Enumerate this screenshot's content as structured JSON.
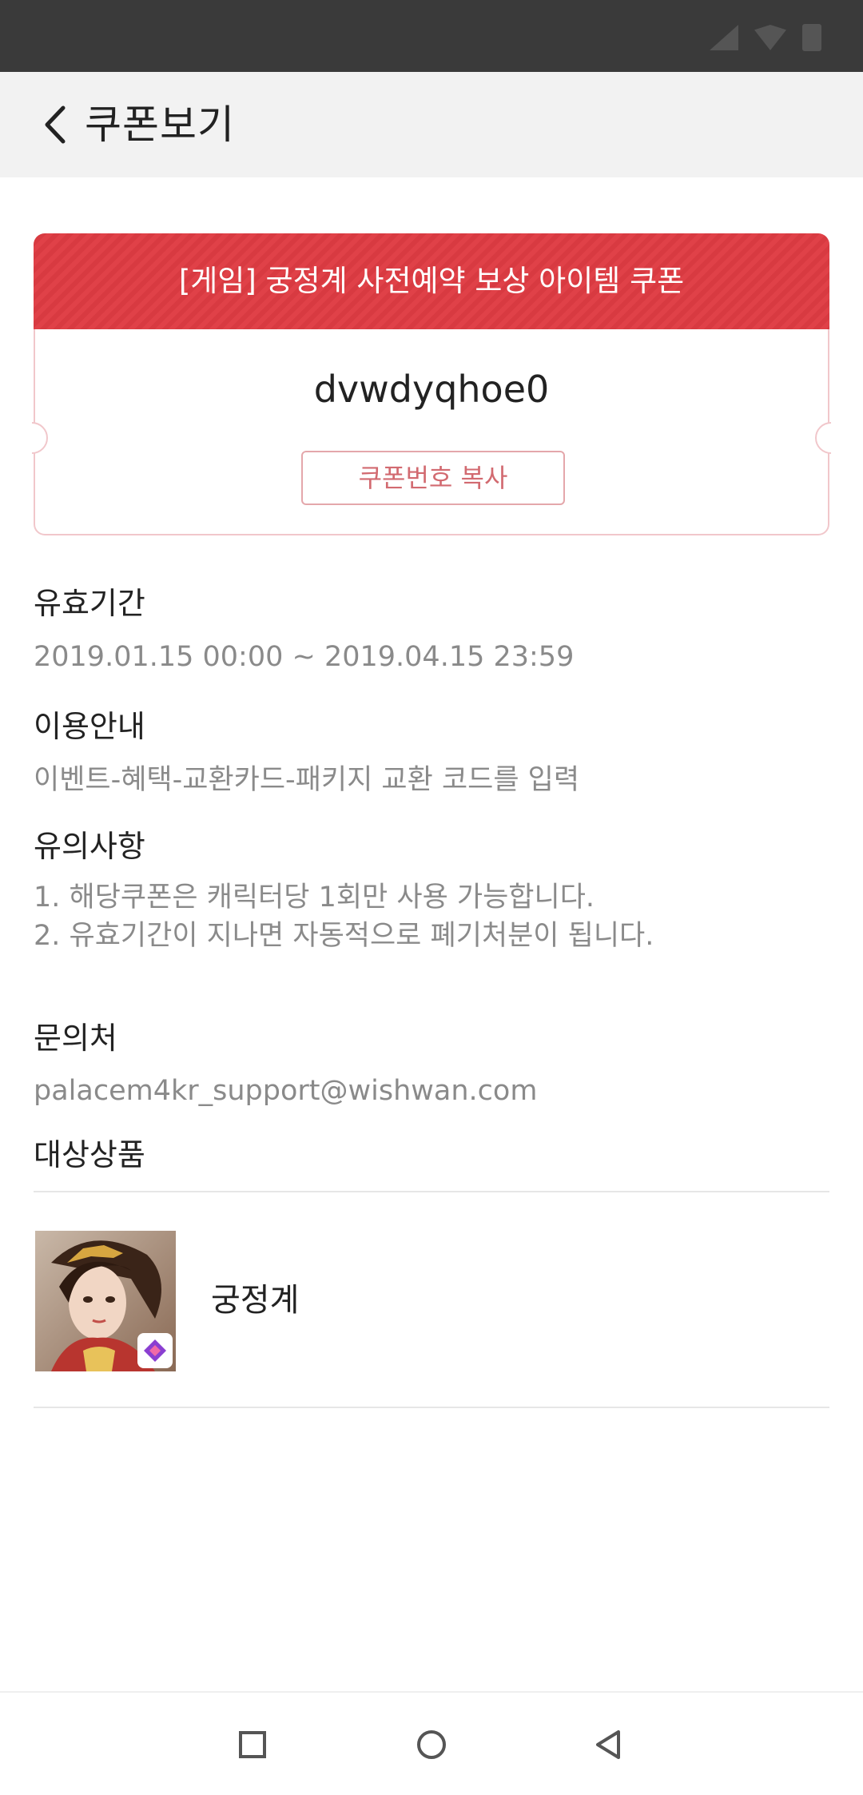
{
  "status_bar": {
    "icons": [
      "signal-icon",
      "wifi-icon",
      "battery-icon"
    ]
  },
  "app_bar": {
    "back_icon": "chevron-left-icon",
    "title": "쿠폰보기"
  },
  "coupon": {
    "title": "[게임] 궁정계 사전예약 보상 아이템 쿠폰",
    "code": "dvwdyqhoe0",
    "copy_label": "쿠폰번호 복사",
    "accent_color": "#e04148"
  },
  "validity": {
    "label": "유효기간",
    "value": "2019.01.15 00:00 ~ 2019.04.15 23:59"
  },
  "usage": {
    "label": "이용안내",
    "value": "이벤트-혜택-교환카드-패키지 교환 코드를 입력"
  },
  "notes": {
    "label": "유의사항",
    "items": [
      "1. 해당쿠폰은 캐릭터당 1회만 사용 가능합니다.",
      "2. 유효기간이 지나면 자동적으로 폐기처분이 됩니다."
    ]
  },
  "contact": {
    "label": "문의처",
    "value": "palacem4kr_support@wishwan.com"
  },
  "target_products": {
    "label": "대상상품",
    "items": [
      {
        "name": "궁정계",
        "thumb_icon": "game-thumbnail"
      }
    ]
  },
  "nav_bar": {
    "icons": [
      "recent-apps-icon",
      "home-icon",
      "back-icon"
    ]
  }
}
